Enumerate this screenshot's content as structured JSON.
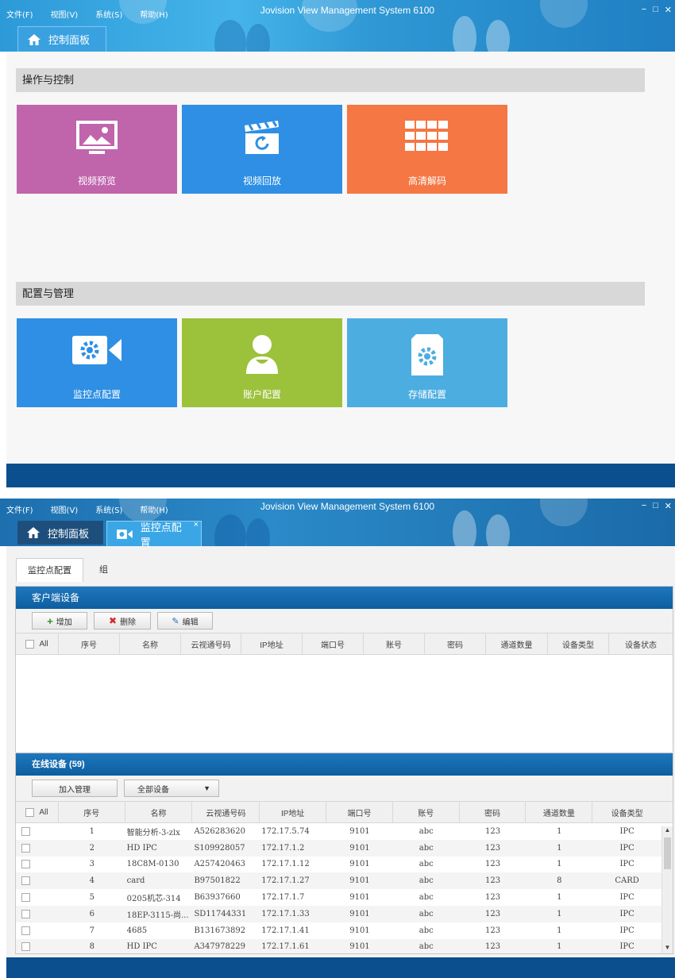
{
  "app": {
    "menu": [
      "文件(F)",
      "视图(V)",
      "系统(S)",
      "帮助(H)"
    ],
    "title": "Jovision View Management System 6100",
    "window_controls": [
      "−",
      "□",
      "✕"
    ]
  },
  "screen1": {
    "tab_home": "控制面板",
    "section_ops": "操作与控制",
    "tiles_ops": [
      {
        "label": "视频预览",
        "color": "#c064ac",
        "icon": "monitor-picture-icon"
      },
      {
        "label": "视频回放",
        "color": "#2e8fe4",
        "icon": "clapperboard-replay-icon"
      },
      {
        "label": "高清解码",
        "color": "#f47744",
        "icon": "grid-decode-icon"
      }
    ],
    "section_cfg": "配置与管理",
    "tiles_cfg": [
      {
        "label": "监控点配置",
        "color": "#2e8fe4",
        "icon": "camera-gear-icon"
      },
      {
        "label": "账户配置",
        "color": "#9cc13b",
        "icon": "user-account-icon"
      },
      {
        "label": "存储配置",
        "color": "#4cade0",
        "icon": "storage-gear-icon"
      }
    ]
  },
  "screen2": {
    "tab_home": "控制面板",
    "tab_cfg": "监控点配置",
    "tab_close": "×",
    "subtabs": [
      "监控点配置",
      "组"
    ],
    "client_panel": {
      "title": "客户端设备",
      "buttons": [
        "增加",
        "删除",
        "编辑"
      ],
      "columns": [
        "All",
        "序号",
        "名称",
        "云视通号码",
        "IP地址",
        "端口号",
        "账号",
        "密码",
        "通道数量",
        "设备类型",
        "设备状态"
      ]
    },
    "online_panel": {
      "title": "在线设备 (59)",
      "add_button": "加入管理",
      "filter_value": "全部设备",
      "columns": [
        "All",
        "序号",
        "名称",
        "云视通号码",
        "IP地址",
        "端口号",
        "账号",
        "密码",
        "通道数量",
        "设备类型"
      ],
      "rows": [
        [
          "1",
          "智能分析-3-zlx",
          "A526283620",
          "172.17.5.74",
          "9101",
          "abc",
          "123",
          "1",
          "IPC"
        ],
        [
          "2",
          "HD IPC",
          "S109928057",
          "172.17.1.2",
          "9101",
          "abc",
          "123",
          "1",
          "IPC"
        ],
        [
          "3",
          "18C8M-0130",
          "A257420463",
          "172.17.1.12",
          "9101",
          "abc",
          "123",
          "1",
          "IPC"
        ],
        [
          "4",
          "card",
          "B97501822",
          "172.17.1.27",
          "9101",
          "abc",
          "123",
          "8",
          "CARD"
        ],
        [
          "5",
          "0205机芯-314",
          "B63937660",
          "172.17.1.7",
          "9101",
          "abc",
          "123",
          "1",
          "IPC"
        ],
        [
          "6",
          "18EP-3115-尚...",
          "SD11744331",
          "172.17.1.33",
          "9101",
          "abc",
          "123",
          "1",
          "IPC"
        ],
        [
          "7",
          "4685",
          "B131673892",
          "172.17.1.41",
          "9101",
          "abc",
          "123",
          "1",
          "IPC"
        ],
        [
          "8",
          "HD IPC",
          "A347978229",
          "172.17.1.61",
          "9101",
          "abc",
          "123",
          "1",
          "IPC"
        ]
      ]
    }
  }
}
